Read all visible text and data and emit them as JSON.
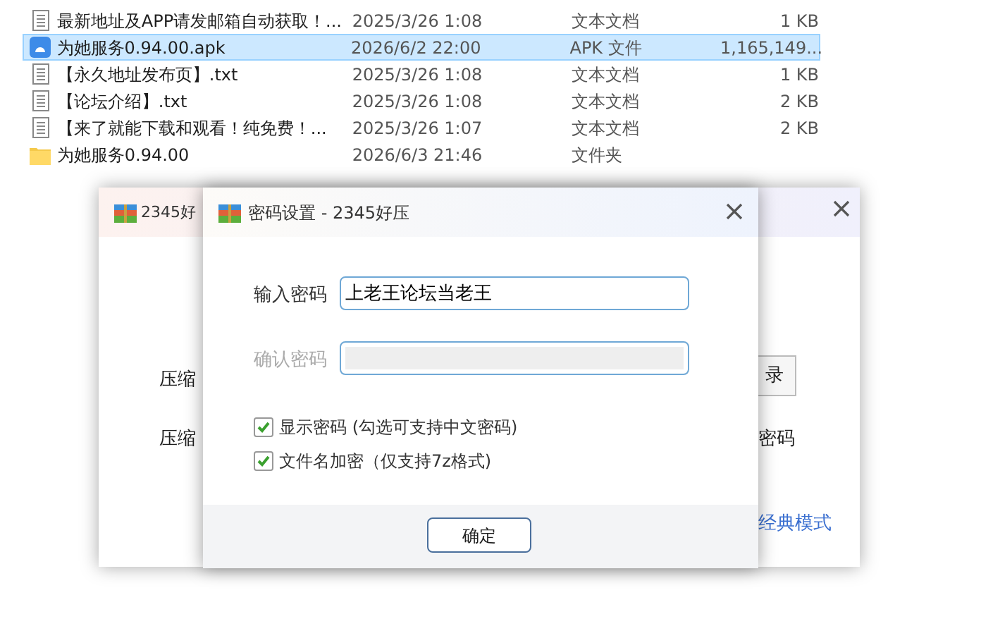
{
  "files": [
    {
      "kind": "text",
      "name": "最新地址及APP请发邮箱自动获取！...",
      "date": "2025/3/26 1:08",
      "type": "文本文档",
      "size": "1 KB",
      "selected": false
    },
    {
      "kind": "apk",
      "name": "为她服务0.94.00.apk",
      "date": "2026/6/2 22:00",
      "type": "APK 文件",
      "size": "1,165,149...",
      "selected": true
    },
    {
      "kind": "text",
      "name": "【永久地址发布页】.txt",
      "date": "2025/3/26 1:08",
      "type": "文本文档",
      "size": "1 KB",
      "selected": false
    },
    {
      "kind": "text",
      "name": "【论坛介绍】.txt",
      "date": "2025/3/26 1:08",
      "type": "文本文档",
      "size": "2 KB",
      "selected": false
    },
    {
      "kind": "text",
      "name": "【来了就能下载和观看！纯免费！...",
      "date": "2025/3/26 1:07",
      "type": "文本文档",
      "size": "2 KB",
      "selected": false
    },
    {
      "kind": "folder",
      "name": "为她服务0.94.00",
      "date": "2026/6/3 21:46",
      "type": "文件夹",
      "selected": false
    }
  ],
  "back_window": {
    "title": "2345好",
    "label_1": "压缩",
    "label_2": "压缩",
    "button": "录",
    "right_text": "密码",
    "link": "经典模式"
  },
  "dialog": {
    "title": "密码设置 - 2345好压",
    "password": {
      "label": "输入密码",
      "value": "上老王论坛当老王",
      "disabled": false
    },
    "confirm": {
      "label": "确认密码",
      "disabled": true
    },
    "options": [
      {
        "label": "显示密码 (勾选可支持中文密码)",
        "checked": true
      },
      {
        "label": "文件名加密（仅支持7z格式)",
        "checked": true
      }
    ],
    "ok_button": "确定"
  }
}
